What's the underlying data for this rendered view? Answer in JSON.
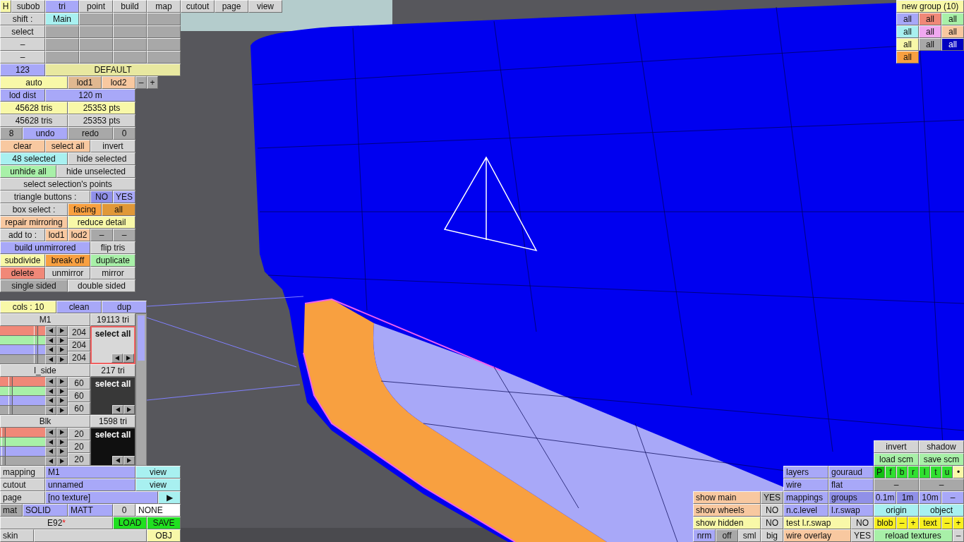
{
  "menu": {
    "help": "H",
    "tabs": [
      {
        "label": "subob",
        "selected": false
      },
      {
        "label": "tri",
        "selected": true
      },
      {
        "label": "point",
        "selected": false
      },
      {
        "label": "build",
        "selected": false
      },
      {
        "label": "map",
        "selected": false
      },
      {
        "label": "cutout",
        "selected": false
      },
      {
        "label": "page",
        "selected": false
      },
      {
        "label": "view",
        "selected": false
      }
    ]
  },
  "edit_panel": [
    [
      {
        "label": "shift :",
        "color": "#d4d4d4"
      },
      {
        "label": "Main",
        "color": "#a8f0f0"
      },
      {
        "color": "#a8a8a8"
      },
      {
        "color": "#a8a8a8"
      },
      {
        "color": "#a8a8a8"
      }
    ],
    [
      {
        "label": "select",
        "color": "#d4d4d4"
      },
      {
        "color": "#a8a8a8"
      },
      {
        "color": "#a8a8a8"
      },
      {
        "color": "#a8a8a8"
      },
      {
        "color": "#a8a8a8"
      }
    ],
    [
      {
        "label": "–",
        "color": "#d4d4d4"
      },
      {
        "color": "#a8a8a8"
      },
      {
        "color": "#a8a8a8"
      },
      {
        "color": "#a8a8a8"
      },
      {
        "color": "#a8a8a8"
      }
    ],
    [
      {
        "label": "–",
        "color": "#d4d4d4"
      },
      {
        "color": "#a8a8a8"
      },
      {
        "color": "#a8a8a8"
      },
      {
        "color": "#a8a8a8"
      },
      {
        "color": "#a8a8a8"
      }
    ],
    [
      {
        "label": "123",
        "color": "#a8a8f8"
      },
      {
        "label": "DEFAULT",
        "color": "#e8e8a0"
      }
    ],
    [
      {
        "label": "auto",
        "color": "#f8f8a8"
      },
      {
        "label": "lod1",
        "color": "#e0b890"
      },
      {
        "label": "lod2",
        "color": "#f8c8a0"
      },
      {
        "label": "–",
        "color": "#a8a8a8"
      },
      {
        "label": "+",
        "color": "#a8a8a8"
      }
    ],
    [
      {
        "label": "lod dist",
        "color": "#a8a8f8"
      },
      {
        "label": "120 m",
        "color": "#a8a8f8"
      }
    ],
    [
      {
        "label": "45628 tris",
        "color": "#f8f8a8"
      },
      {
        "label": "25353 pts",
        "color": "#f8f8a8"
      }
    ],
    [
      {
        "label": "45628 tris",
        "color": "#d4d4d4"
      },
      {
        "label": "25353 pts",
        "color": "#d4d4d4"
      }
    ],
    [
      {
        "label": "8",
        "color": "#a8a8a8"
      },
      {
        "label": "undo",
        "color": "#a8a8f8"
      },
      {
        "label": "redo",
        "color": "#a8a8a8"
      },
      {
        "label": "0",
        "color": "#a8a8a8"
      }
    ],
    [
      {
        "label": "clear",
        "color": "#f8c8a0"
      },
      {
        "label": "select all",
        "color": "#f8c8a0"
      },
      {
        "label": "invert",
        "color": "#d4d4d4"
      }
    ],
    [
      {
        "label": "48 selected",
        "color": "#a8f0f0"
      },
      {
        "label": "hide selected",
        "color": "#d4d4d4"
      }
    ],
    [
      {
        "label": "unhide all",
        "color": "#a8f0a8"
      },
      {
        "label": "hide unselected",
        "color": "#d4d4d4"
      }
    ],
    [
      {
        "label": "select selection's points",
        "color": "#d4d4d4"
      }
    ],
    [
      {
        "label": "triangle buttons :",
        "color": "#d4d4d4"
      },
      {
        "label": "NO",
        "color": "#9090e8"
      },
      {
        "label": "YES",
        "color": "#a8a8f8"
      }
    ],
    [
      {
        "label": "box select :",
        "color": "#d4d4d4"
      },
      {
        "label": "facing",
        "color": "#f8a040"
      },
      {
        "label": "all",
        "color": "#e09838"
      }
    ],
    [
      {
        "label": "repair mirroring",
        "color": "#f8c8a0"
      },
      {
        "label": "reduce detail",
        "color": "#f8f8a8"
      }
    ],
    [
      {
        "label": "add to :",
        "color": "#d4d4d4"
      },
      {
        "label": "lod1",
        "color": "#f8c8a0"
      },
      {
        "label": "lod2",
        "color": "#f8c8a0"
      },
      {
        "label": "–",
        "color": "#a8a8a8"
      },
      {
        "label": "–",
        "color": "#a8a8a8"
      }
    ],
    [
      {
        "label": "build unmirrored",
        "color": "#a8a8f8"
      },
      {
        "label": "flip tris",
        "color": "#d4d4d4"
      }
    ],
    [
      {
        "label": "subdivide",
        "color": "#f8f8a8"
      },
      {
        "label": "break off",
        "color": "#f8a040"
      },
      {
        "label": "duplicate",
        "color": "#a8f0a8"
      }
    ],
    [
      {
        "label": "delete",
        "color": "#f08878"
      },
      {
        "label": "unmirror",
        "color": "#d4d4d4"
      },
      {
        "label": "mirror",
        "color": "#d4d4d4"
      }
    ],
    [
      {
        "label": "single sided",
        "color": "#a8a8a8"
      },
      {
        "label": "double sided",
        "color": "#d4d4d4"
      }
    ]
  ],
  "materials_header": [
    {
      "label": "cols : 10",
      "color": "#f8f8a8"
    },
    {
      "label": "clean",
      "color": "#a8a8f8"
    },
    {
      "label": "dup",
      "color": "#a8a8f8"
    }
  ],
  "materials": [
    {
      "name": "M1",
      "tris": "19113 tri",
      "color": "#d8d8d8",
      "selected": true,
      "sliders": [
        {
          "level": 0.8
        },
        {
          "level": 0.8
        },
        {
          "level": 0.8
        },
        {
          "level": 0.8
        }
      ],
      "values": [
        "204",
        "204",
        "204"
      ],
      "action": "select all"
    },
    {
      "name": "l_side",
      "tris": "217 tri",
      "color": "#383838",
      "selected": false,
      "sliders": [
        {
          "level": 0.23
        },
        {
          "level": 0.23
        },
        {
          "level": 0.23
        },
        {
          "level": 0.23
        }
      ],
      "values": [
        "60",
        "60",
        "60"
      ],
      "action": "select all"
    },
    {
      "name": "Blk",
      "tris": "1598 tri",
      "color": "#101010",
      "selected": false,
      "sliders": [
        {
          "level": 0.08
        },
        {
          "level": 0.08
        },
        {
          "level": 0.08
        },
        {
          "level": 0.08
        }
      ],
      "values": [
        "20",
        "20",
        "20"
      ],
      "action": "select all"
    }
  ],
  "file_panel": [
    [
      {
        "label": "mapping",
        "color": "#d4d4d4"
      },
      {
        "label": "M1",
        "color": "#a8a8f8"
      },
      {
        "label": "view",
        "color": "#a8f0f0"
      }
    ],
    [
      {
        "label": "cutout",
        "color": "#d4d4d4"
      },
      {
        "label": "unnamed",
        "color": "#a8a8f8"
      },
      {
        "label": "view",
        "color": "#a8f0f0"
      }
    ],
    [
      {
        "label": "page",
        "color": "#d4d4d4"
      },
      {
        "label": "[no texture]",
        "color": "#a8a8f8"
      },
      {
        "label": "▶",
        "color": "#a8f0f0"
      }
    ],
    [
      {
        "label": "mat",
        "color": "#a8a8a8"
      },
      {
        "label": "SOLID",
        "color": "#a8a8f8"
      },
      {
        "label": "MATT",
        "color": "#a8a8f8"
      },
      {
        "label": "0",
        "color": "#d4d4d4"
      },
      {
        "label": "NONE",
        "color": "#ffffff"
      }
    ],
    [
      {
        "label": "E92",
        "flag": "*",
        "color": "#d4d4d4"
      },
      {
        "label": "LOAD",
        "color": "#20e020"
      },
      {
        "label": "SAVE",
        "color": "#20e020"
      }
    ],
    [
      {
        "label": "skin",
        "color": "#d4d4d4"
      },
      {
        "color": "#d4d4d4"
      },
      {
        "label": "OBJ",
        "color": "#f8f8a8"
      }
    ]
  ],
  "groups": {
    "title": "new group (10)",
    "buttons": [
      {
        "label": "all",
        "color": "#a8a8f8"
      },
      {
        "label": "all",
        "color": "#f08878"
      },
      {
        "label": "all",
        "color": "#a8f0a8"
      },
      {
        "label": "all",
        "color": "#a8f0f0"
      },
      {
        "label": "all",
        "color": "#f0a8f0"
      },
      {
        "label": "all",
        "color": "#f8c8a0"
      },
      {
        "label": "all",
        "color": "#f8f8a8"
      },
      {
        "label": "all",
        "color": "#a8a8a8"
      },
      {
        "label": "all",
        "color": "#0000c0"
      },
      {
        "label": "all",
        "color": "#f8a040"
      }
    ]
  },
  "view_options": [
    [
      {
        "label": "show main",
        "color": "#f8c8a0"
      },
      {
        "label": "YES",
        "color": "#b8b8b8"
      }
    ],
    [
      {
        "label": "show wheels",
        "color": "#f8c8a0"
      },
      {
        "label": "NO",
        "color": "#d4d4d4"
      }
    ],
    [
      {
        "label": "show hidden",
        "color": "#f8f8a8"
      },
      {
        "label": "NO",
        "color": "#d4d4d4"
      }
    ],
    [
      {
        "label": "nrm",
        "color": "#a8a8f8"
      },
      {
        "label": "off",
        "color": "#a8a8a8"
      },
      {
        "label": "sml",
        "color": "#d4d4d4"
      },
      {
        "label": "big",
        "color": "#d4d4d4"
      }
    ]
  ],
  "render_options": [
    [
      {
        "label": "layers",
        "color": "#a8a8f8"
      },
      {
        "label": "gouraud",
        "color": "#a8a8f8"
      }
    ],
    [
      {
        "label": "wire",
        "color": "#a8a8f8"
      },
      {
        "label": "flat",
        "color": "#a8a8f8"
      }
    ],
    [
      {
        "label": "mappings",
        "color": "#a8a8f8"
      },
      {
        "label": "groups",
        "color": "#9090e8"
      }
    ],
    [
      {
        "label": "n.c.level",
        "color": "#a8a8f8"
      },
      {
        "label": "l.r.swap",
        "color": "#a8a8f8"
      }
    ],
    [
      {
        "label": "test l.r.swap",
        "color": "#f8f8a8"
      },
      {
        "label": "NO",
        "color": "#d4d4d4"
      }
    ],
    [
      {
        "label": "wire overlay",
        "color": "#f8c8a0"
      },
      {
        "label": "YES",
        "color": "#d4d4d4"
      }
    ]
  ],
  "tools": [
    [
      {
        "label": "invert",
        "color": "#d4d4d4"
      },
      {
        "label": "shadow",
        "color": "#d4d4d4"
      }
    ],
    [
      {
        "label": "load scm",
        "color": "#a8f0a8"
      },
      {
        "label": "save scm",
        "color": "#a8f0a8"
      }
    ],
    [
      {
        "label": "P",
        "color": "#10c010"
      },
      {
        "label": "f",
        "color": "#30e030"
      },
      {
        "label": "b",
        "color": "#30e030"
      },
      {
        "label": "r",
        "color": "#30e030"
      },
      {
        "label": "l",
        "color": "#30e030"
      },
      {
        "label": "t",
        "color": "#30e030"
      },
      {
        "label": "u",
        "color": "#30e030"
      },
      {
        "label": "•",
        "color": "#f8f8a8"
      }
    ],
    [
      {
        "label": "–",
        "color": "#a8a8a8"
      },
      {
        "label": "–",
        "color": "#a8a8a8"
      }
    ],
    [
      {
        "label": "0.1m",
        "color": "#a8a8f8"
      },
      {
        "label": "1m",
        "color": "#9090e8"
      },
      {
        "label": "10m",
        "color": "#a8a8f8"
      },
      {
        "label": "–",
        "color": "#a8a8f8"
      }
    ],
    [
      {
        "label": "origin",
        "color": "#a8f0f0"
      },
      {
        "label": "object",
        "color": "#a8f0f0"
      }
    ],
    [
      {
        "label": "blob",
        "color": "#f8f020"
      },
      {
        "label": "–",
        "color": "#f8f020"
      },
      {
        "label": "+",
        "color": "#f8f020"
      },
      {
        "label": "text",
        "color": "#f8f020"
      },
      {
        "label": "–",
        "color": "#f8f020"
      },
      {
        "label": "+",
        "color": "#f8f020"
      }
    ],
    [
      {
        "label": "reload textures",
        "color": "#a8f0a8"
      },
      {
        "label": "–",
        "color": "#d4d4d4"
      }
    ]
  ]
}
